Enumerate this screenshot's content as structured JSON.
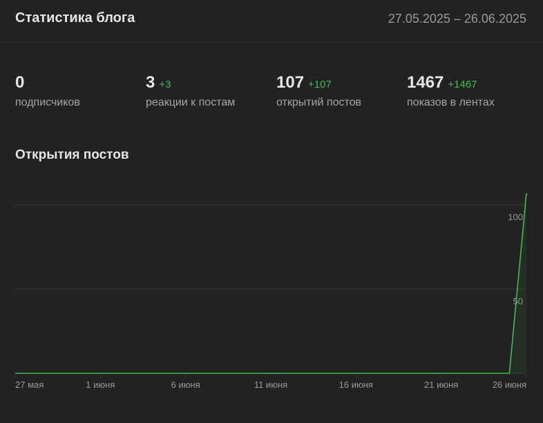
{
  "header": {
    "title": "Статистика блога",
    "date_range": "27.05.2025 – 26.06.2025"
  },
  "stats": [
    {
      "value": "0",
      "delta": "",
      "label": "подписчиков"
    },
    {
      "value": "3",
      "delta": "+3",
      "label": "реакции к постам"
    },
    {
      "value": "107",
      "delta": "+107",
      "label": "открытий постов"
    },
    {
      "value": "1467",
      "delta": "+1467",
      "label": "показов в лентах"
    }
  ],
  "section": {
    "title": "Открытия постов"
  },
  "colors": {
    "background": "#222222",
    "gridline": "#3a3a3a",
    "line": "#3fbf4f",
    "delta": "#3fbf4f",
    "muted_text": "#9a9a9a"
  },
  "chart_data": {
    "type": "area",
    "title": "",
    "xlabel": "",
    "ylabel": "",
    "x": [
      "27 мая",
      "28 мая",
      "29 мая",
      "30 мая",
      "31 мая",
      "1 июня",
      "2 июня",
      "3 июня",
      "4 июня",
      "5 июня",
      "6 июня",
      "7 июня",
      "8 июня",
      "9 июня",
      "10 июня",
      "11 июня",
      "12 июня",
      "13 июня",
      "14 июня",
      "15 июня",
      "16 июня",
      "17 июня",
      "18 июня",
      "19 июня",
      "20 июня",
      "21 июня",
      "22 июня",
      "23 июня",
      "24 июня",
      "25 июня",
      "26 июня"
    ],
    "values": [
      0,
      0,
      0,
      0,
      0,
      0,
      0,
      0,
      0,
      0,
      0,
      0,
      0,
      0,
      0,
      0,
      0,
      0,
      0,
      0,
      0,
      0,
      0,
      0,
      0,
      0,
      0,
      0,
      0,
      0,
      107
    ],
    "ylim": [
      0,
      107
    ],
    "yticks": [
      50,
      100
    ],
    "xtick_labels": [
      "27 мая",
      "1 июня",
      "6 июня",
      "11 июня",
      "16 июня",
      "21 июня",
      "26 июня"
    ],
    "grid": true,
    "legend": "none"
  }
}
